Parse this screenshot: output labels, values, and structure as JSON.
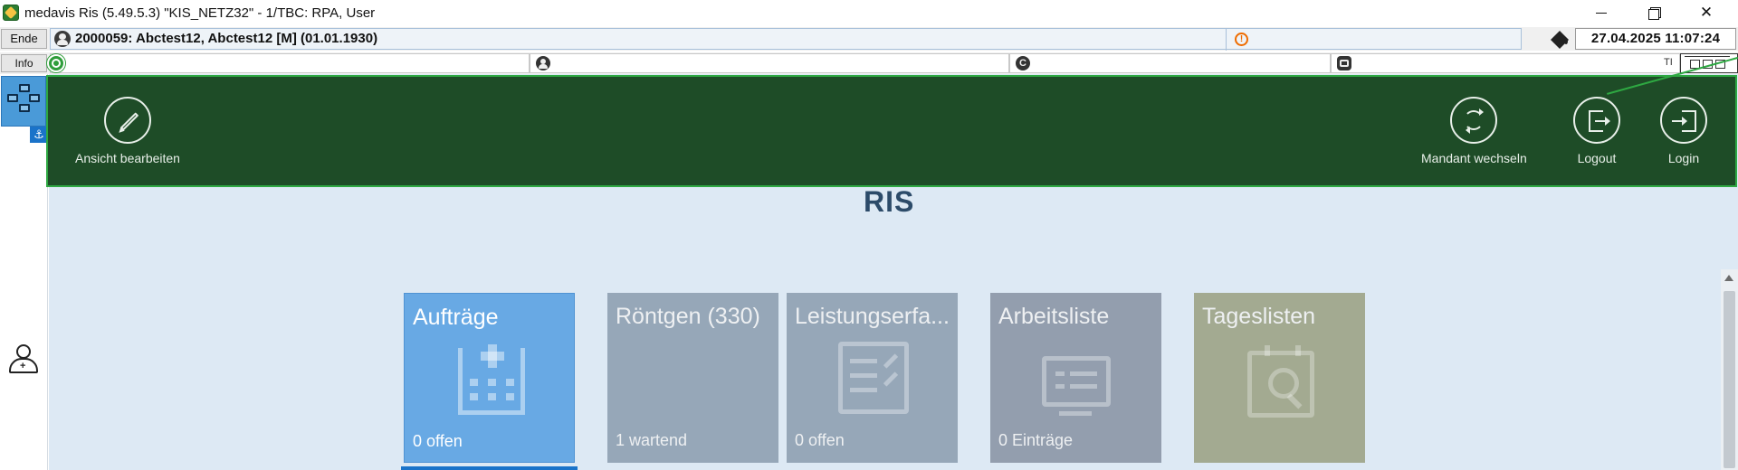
{
  "window": {
    "title": "medavis Ris (5.49.5.3) \"KIS_NETZ32\" - 1/TBC: RPA, User",
    "minimize_icon": "minimize-icon",
    "maximize_icon": "restore-icon",
    "close_icon": "close-icon",
    "close_glyph": "✕"
  },
  "toolbar": {
    "ende_label": "Ende",
    "info_label": "Info",
    "patient_text": "2000059: Abctest12, Abctest12 [M] (01.01.1930)",
    "warning_glyph": "!",
    "datetime": "27.04.2025 11:07:24",
    "ti_label": "TI"
  },
  "sidebar": {
    "anchor_glyph": "⚓",
    "add_plus": "+"
  },
  "ribbon": {
    "edit_view_label": "Ansicht bearbeiten",
    "switch_client_label": "Mandant wechseln",
    "logout_label": "Logout",
    "login_label": "Login"
  },
  "logo": "RIS",
  "tiles": [
    {
      "title": "Aufträge",
      "subtitle": "0 offen",
      "icon": "hospital-icon"
    },
    {
      "title": "Röntgen (330)",
      "subtitle": "1 wartend",
      "icon": ""
    },
    {
      "title": "Leistungserfa...",
      "subtitle": "0 offen",
      "icon": "checklist-icon"
    },
    {
      "title": "Arbeitsliste",
      "subtitle": "0 Einträge",
      "icon": "monitor-icon"
    },
    {
      "title": "Tageslisten",
      "subtitle": "",
      "icon": "calendar-search-icon"
    }
  ],
  "colors": {
    "ribbon_bg": "#1e4c27",
    "ribbon_border": "#2ea842",
    "selected_tile": "#68a9e4",
    "accent": "#1a73c9"
  }
}
